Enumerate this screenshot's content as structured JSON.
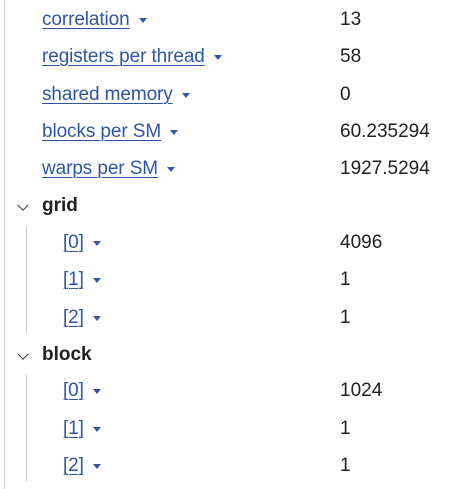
{
  "properties": [
    {
      "key": "correlation",
      "value": "13"
    },
    {
      "key": "registers per thread",
      "value": "58"
    },
    {
      "key": "shared memory",
      "value": "0"
    },
    {
      "key": "blocks per SM",
      "value": "60.235294"
    },
    {
      "key": "warps per SM",
      "value": "1927.5294"
    }
  ],
  "grid": {
    "title": "grid",
    "expanded": true,
    "items": [
      {
        "key": "[0]",
        "value": "4096"
      },
      {
        "key": "[1]",
        "value": "1"
      },
      {
        "key": "[2]",
        "value": "1"
      }
    ]
  },
  "block": {
    "title": "block",
    "expanded": true,
    "items": [
      {
        "key": "[0]",
        "value": "1024"
      },
      {
        "key": "[1]",
        "value": "1"
      },
      {
        "key": "[2]",
        "value": "1"
      }
    ]
  },
  "colors": {
    "link": "#2f56a4",
    "text": "#202124",
    "border": "#d0d0d0"
  },
  "icons": {
    "dropdown": "caret-down-icon",
    "expanded": "chevron-down-icon"
  }
}
